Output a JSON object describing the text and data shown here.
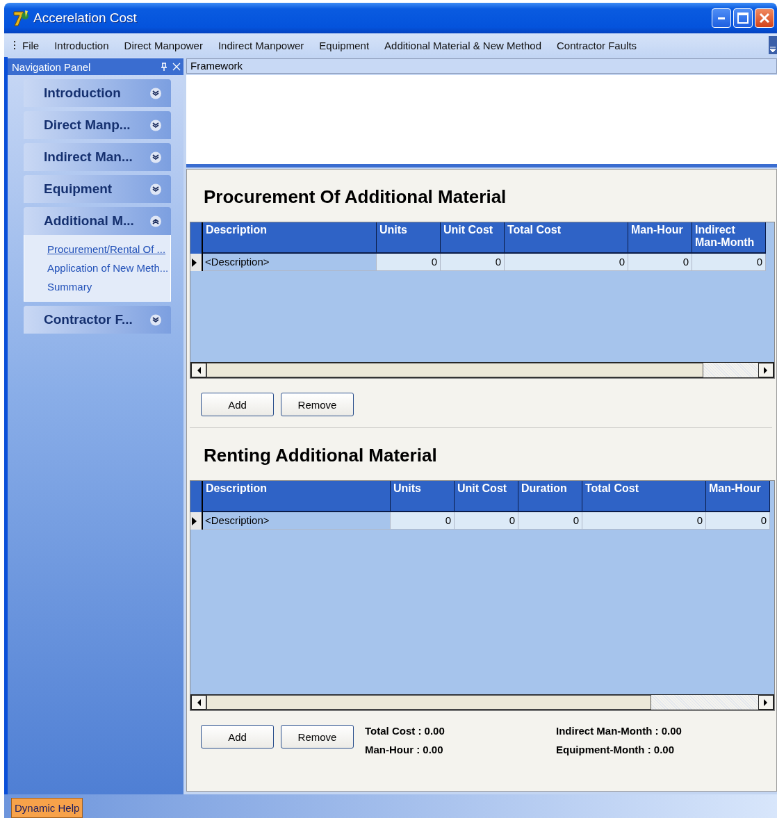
{
  "window": {
    "title": "Accerelation Cost"
  },
  "menu": [
    {
      "label": "File"
    },
    {
      "label": "Introduction"
    },
    {
      "label": "Direct Manpower"
    },
    {
      "label": "Indirect Manpower"
    },
    {
      "label": "Equipment"
    },
    {
      "label": "Additional Material & New Method"
    },
    {
      "label": "Contractor Faults"
    }
  ],
  "navigation_panel": {
    "title": "Navigation Panel",
    "groups": [
      {
        "label": "Introduction",
        "expanded": false
      },
      {
        "label": "Direct Manp...",
        "expanded": false
      },
      {
        "label": "Indirect Man...",
        "expanded": false
      },
      {
        "label": "Equipment",
        "expanded": false
      },
      {
        "label": "Additional M...",
        "expanded": true,
        "items": [
          {
            "label": "Procurement/Rental Of ...",
            "selected": true
          },
          {
            "label": "Application of New Meth...",
            "selected": false
          },
          {
            "label": "Summary",
            "selected": false
          }
        ]
      },
      {
        "label": "Contractor F...",
        "expanded": false
      }
    ]
  },
  "document_tab": {
    "label": "Framework"
  },
  "sections": [
    {
      "title": "Procurement Of Additional Material",
      "columns": [
        "Description",
        "Units",
        "Unit Cost",
        "Total Cost",
        "Man-Hour",
        "Indirect Man-Month"
      ],
      "rows": [
        {
          "cells": [
            "<Description>",
            "0",
            "0",
            "0",
            "0",
            "0"
          ],
          "selected": true
        }
      ],
      "buttons": [
        "Add",
        "Remove"
      ]
    },
    {
      "title": "Renting Additional Material",
      "columns": [
        "Description",
        "Units",
        "Unit Cost",
        "Duration",
        "Total Cost",
        "Man-Hour"
      ],
      "rows": [
        {
          "cells": [
            "<Description>",
            "0",
            "0",
            "0",
            "0",
            "0"
          ],
          "selected": true
        }
      ],
      "buttons": [
        "Add",
        "Remove"
      ],
      "totals": [
        "Total Cost : 0.00",
        "Indirect Man-Month : 0.00",
        "Man-Hour : 0.00",
        "Equipment-Month : 0.00"
      ]
    }
  ],
  "status_bar": {
    "tabs": [
      {
        "label": "Dynamic Help"
      }
    ]
  }
}
